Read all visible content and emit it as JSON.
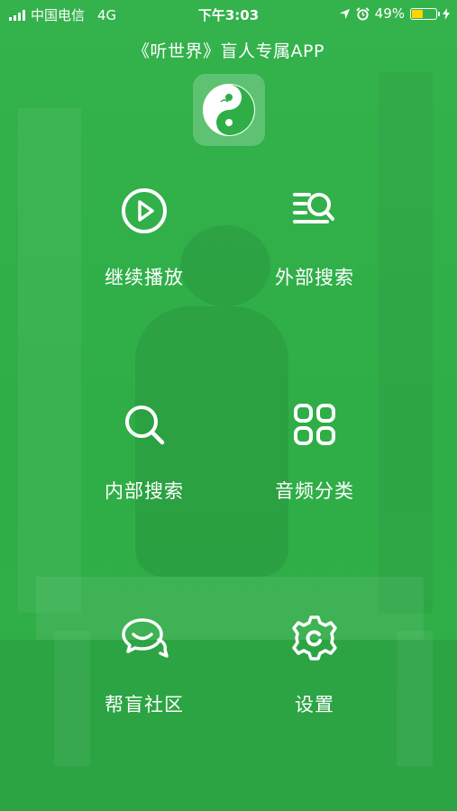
{
  "status_bar": {
    "carrier": "中国电信",
    "network": "4G",
    "time": "下午3:03",
    "battery": "49%",
    "battery_level": 0.49,
    "icons": [
      "signal-icon",
      "location-icon",
      "alarm-icon",
      "battery-icon",
      "charging-icon"
    ]
  },
  "header": {
    "title": "《听世界》盲人专属APP",
    "logo_icon": "yin-yang-logo-icon"
  },
  "menu": [
    {
      "label": "继续播放",
      "icon": "play-circle-icon"
    },
    {
      "label": "外部搜索",
      "icon": "list-search-icon"
    },
    {
      "label": "内部搜索",
      "icon": "search-icon"
    },
    {
      "label": "音频分类",
      "icon": "category-grid-icon"
    },
    {
      "label": "帮盲社区",
      "icon": "chat-bubbles-icon"
    },
    {
      "label": "设置",
      "icon": "gear-icon"
    }
  ],
  "colors": {
    "background": "#32b04a",
    "battery_fill": "#ffd400",
    "foreground": "#ffffff"
  }
}
